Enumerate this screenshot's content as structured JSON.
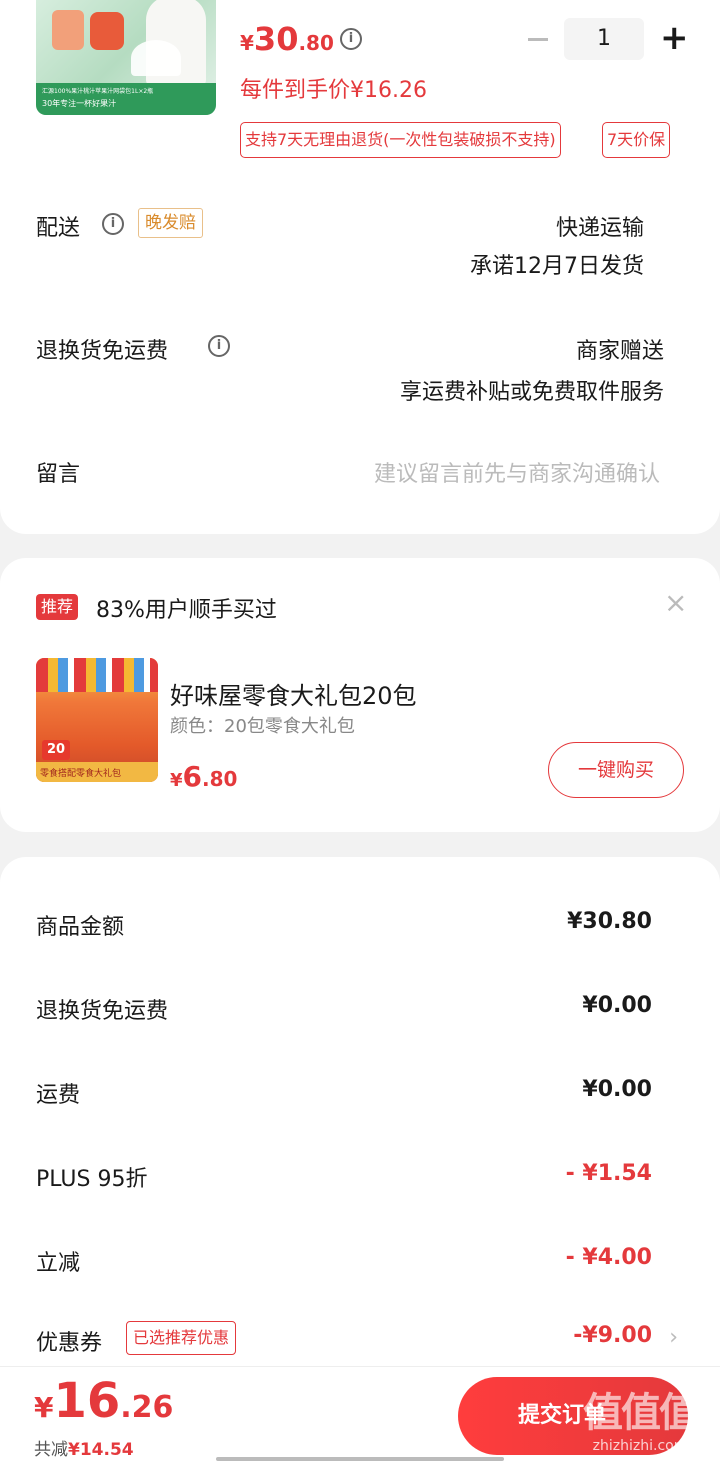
{
  "product": {
    "image_caption_1": "汇源100%果汁桃汁苹果汁网袋包1L×2瓶",
    "image_caption_2": "30年专注一杯好果汁",
    "price_symbol": "¥",
    "price_int": "30",
    "price_dec": ".80",
    "quantity": "1",
    "per_price": "每件到手价¥16.26",
    "tag_return": "支持7天无理由退货(一次性包装破损不支持)",
    "tag_price_protect": "7天价保"
  },
  "delivery": {
    "label": "配送",
    "badge": "晚发赔",
    "method": "快递运输",
    "promise": "承诺12月7日发货"
  },
  "return_shipping": {
    "label": "退换货免运费",
    "value": "商家赠送",
    "desc": "享运费补贴或免费取件服务"
  },
  "message": {
    "label": "留言",
    "placeholder": "建议留言前先与商家沟通确认"
  },
  "recommend": {
    "badge": "推荐",
    "text": "83%用户顺手买过",
    "close": "×",
    "image_num": "20",
    "image_caption": "零食搭配零食大礼包",
    "title": "好味屋零食大礼包20包",
    "spec": "颜色：20包零食大礼包",
    "price_symbol": "¥",
    "price_int": "6",
    "price_dec": ".80",
    "button": "一键购买"
  },
  "summary": {
    "rows": [
      {
        "label": "商品金额",
        "value": "¥30.80"
      },
      {
        "label": "退换货免运费",
        "value": "¥0.00"
      },
      {
        "label": "运费",
        "value": "¥0.00"
      },
      {
        "label": "PLUS 95折",
        "value": "- ¥1.54"
      },
      {
        "label": "立减",
        "value": "- ¥4.00"
      }
    ],
    "coupon_label": "优惠券",
    "coupon_badge": "已选推荐优惠",
    "coupon_value": "-¥9.00",
    "chevron": "›"
  },
  "bottom": {
    "total_symbol": "¥",
    "total_int": "16",
    "total_dec": ".26",
    "saved_prefix": "共减",
    "saved_value": "¥14.54",
    "submit": "提交订单"
  },
  "watermark": {
    "big": "值值值",
    "small": "zhizhizhi.com"
  },
  "colors": {
    "accent": "#e4393c",
    "badge_orange": "#d98b2c"
  }
}
